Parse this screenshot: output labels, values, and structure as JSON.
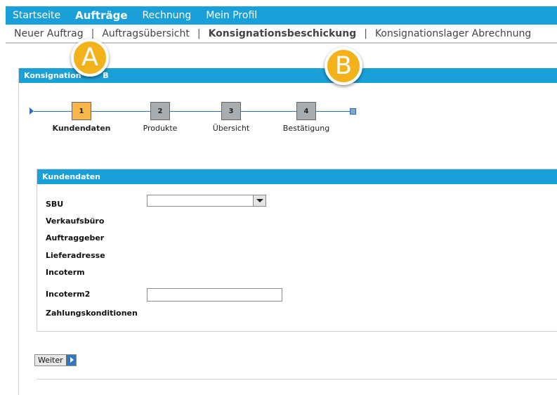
{
  "top_nav": {
    "items": [
      {
        "label": "Startseite",
        "active": false
      },
      {
        "label": "Aufträge",
        "active": true
      },
      {
        "label": "Rechnung",
        "active": false
      },
      {
        "label": "Mein Profil",
        "active": false
      }
    ]
  },
  "sub_nav": {
    "items": [
      {
        "label": "Neuer Auftrag",
        "active": false
      },
      {
        "label": "Auftragsübersicht",
        "active": false
      },
      {
        "label": "Konsignationsbeschickung",
        "active": true
      },
      {
        "label": "Konsignationslager Abrechnung",
        "active": false
      }
    ],
    "separator": "|"
  },
  "callouts": {
    "a": "A",
    "b": "B"
  },
  "main": {
    "header_title": "Konsignation        B"
  },
  "stepper": {
    "current_step": 1,
    "steps": [
      {
        "number": "1",
        "label": "Kundendaten"
      },
      {
        "number": "2",
        "label": "Produkte"
      },
      {
        "number": "3",
        "label": "Übersicht"
      },
      {
        "number": "4",
        "label": "Bestätigung"
      }
    ]
  },
  "customer_panel": {
    "title": "Kundendaten",
    "fields": {
      "sbu": {
        "label": "SBU",
        "value": ""
      },
      "verkaufsbuero": {
        "label": "Verkaufsbüro",
        "value": ""
      },
      "auftraggeber": {
        "label": "Auftraggeber",
        "value": ""
      },
      "lieferadresse": {
        "label": "Lieferadresse",
        "value": ""
      },
      "incoterm": {
        "label": "Incoterm",
        "value": ""
      },
      "incoterm2": {
        "label": "Incoterm2",
        "value": ""
      },
      "zahlungskonditionen": {
        "label": "Zahlungskonditionen",
        "value": ""
      }
    }
  },
  "actions": {
    "next_label": "Weiter"
  },
  "colors": {
    "nav_blue": "#1aa0d8",
    "step_current": "#f7b54a",
    "step_pending": "#a8adb2",
    "callout_orange": "#f3b21a"
  },
  "icons": {
    "select_arrow": "chevron-down-icon",
    "next_arrow": "arrow-right-icon"
  }
}
